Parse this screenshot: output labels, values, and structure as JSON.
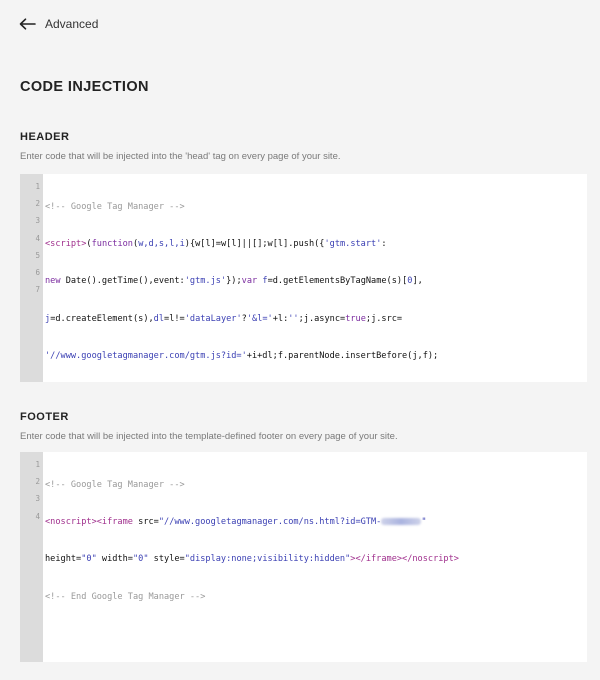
{
  "nav": {
    "back_label": "Advanced"
  },
  "page": {
    "title": "CODE INJECTION"
  },
  "header_section": {
    "title": "HEADER",
    "description": "Enter code that will be injected into the 'head' tag on every page of your site.",
    "line_numbers": [
      "1",
      "2",
      "3",
      "4",
      "5",
      "6",
      "7"
    ]
  },
  "footer_section": {
    "title": "FOOTER",
    "description": "Enter code that will be injected into the template-defined footer on every page of your site.",
    "line_numbers": [
      "1",
      "2",
      "3",
      "4"
    ]
  },
  "colors": {
    "background": "#f4f4f4",
    "gutter": "#dcdcdc",
    "tag": "#a0308d",
    "string": "#3a3fb3",
    "comment": "#999999"
  }
}
